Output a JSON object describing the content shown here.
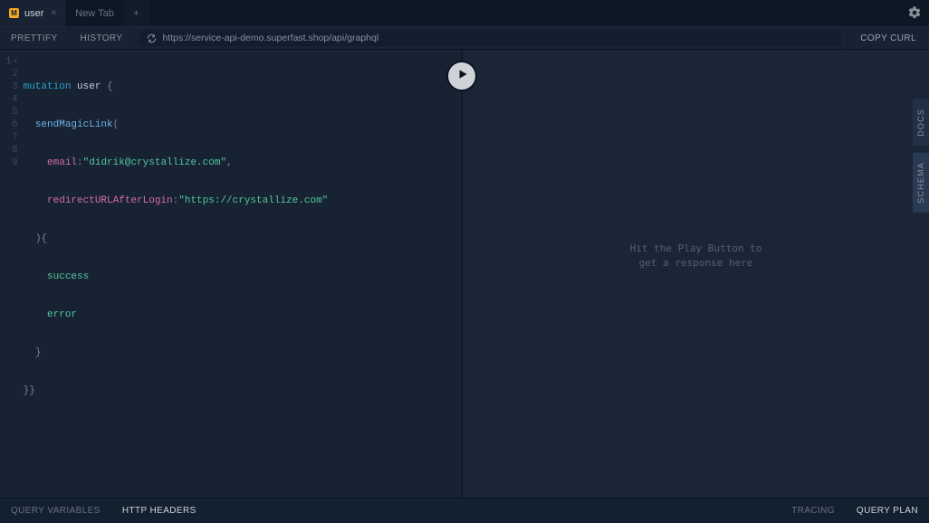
{
  "tabs": {
    "active_badge": "M",
    "active_label": "user",
    "new_tab_label": "New Tab",
    "plus_label": "+"
  },
  "toolbar": {
    "prettify": "PRETTIFY",
    "history": "HISTORY",
    "url": "https://service-api-demo.superfast.shop/api/graphql",
    "copy_curl": "COPY CURL"
  },
  "rail": {
    "docs": "DOCS",
    "schema": "SCHEMA"
  },
  "editor": {
    "line_numbers": [
      "1",
      "2",
      "3",
      "4",
      "5",
      "6",
      "7",
      "8",
      "9"
    ],
    "l1_kw": "mutation",
    "l1_name": " user",
    "l1_tail": " {",
    "l2_fn": "sendMagicLink",
    "l2_tail": "(",
    "l3_key": "email",
    "l3_colon": ":",
    "l3_val": "\"didrik@crystallize.com\"",
    "l3_comma": ",",
    "l4_key": "redirectURLAfterLogin",
    "l4_colon": ":",
    "l4_val": "\"https://crystallize.com\"",
    "l5": "){",
    "l6": "success",
    "l7": "error",
    "l8": "}",
    "l9": "}}"
  },
  "result": {
    "placeholder_line1": "Hit the Play Button to",
    "placeholder_line2": "get a response here"
  },
  "bottom": {
    "query_vars": "QUERY VARIABLES",
    "http_headers": "HTTP HEADERS",
    "tracing": "TRACING",
    "query_plan": "QUERY PLAN"
  }
}
